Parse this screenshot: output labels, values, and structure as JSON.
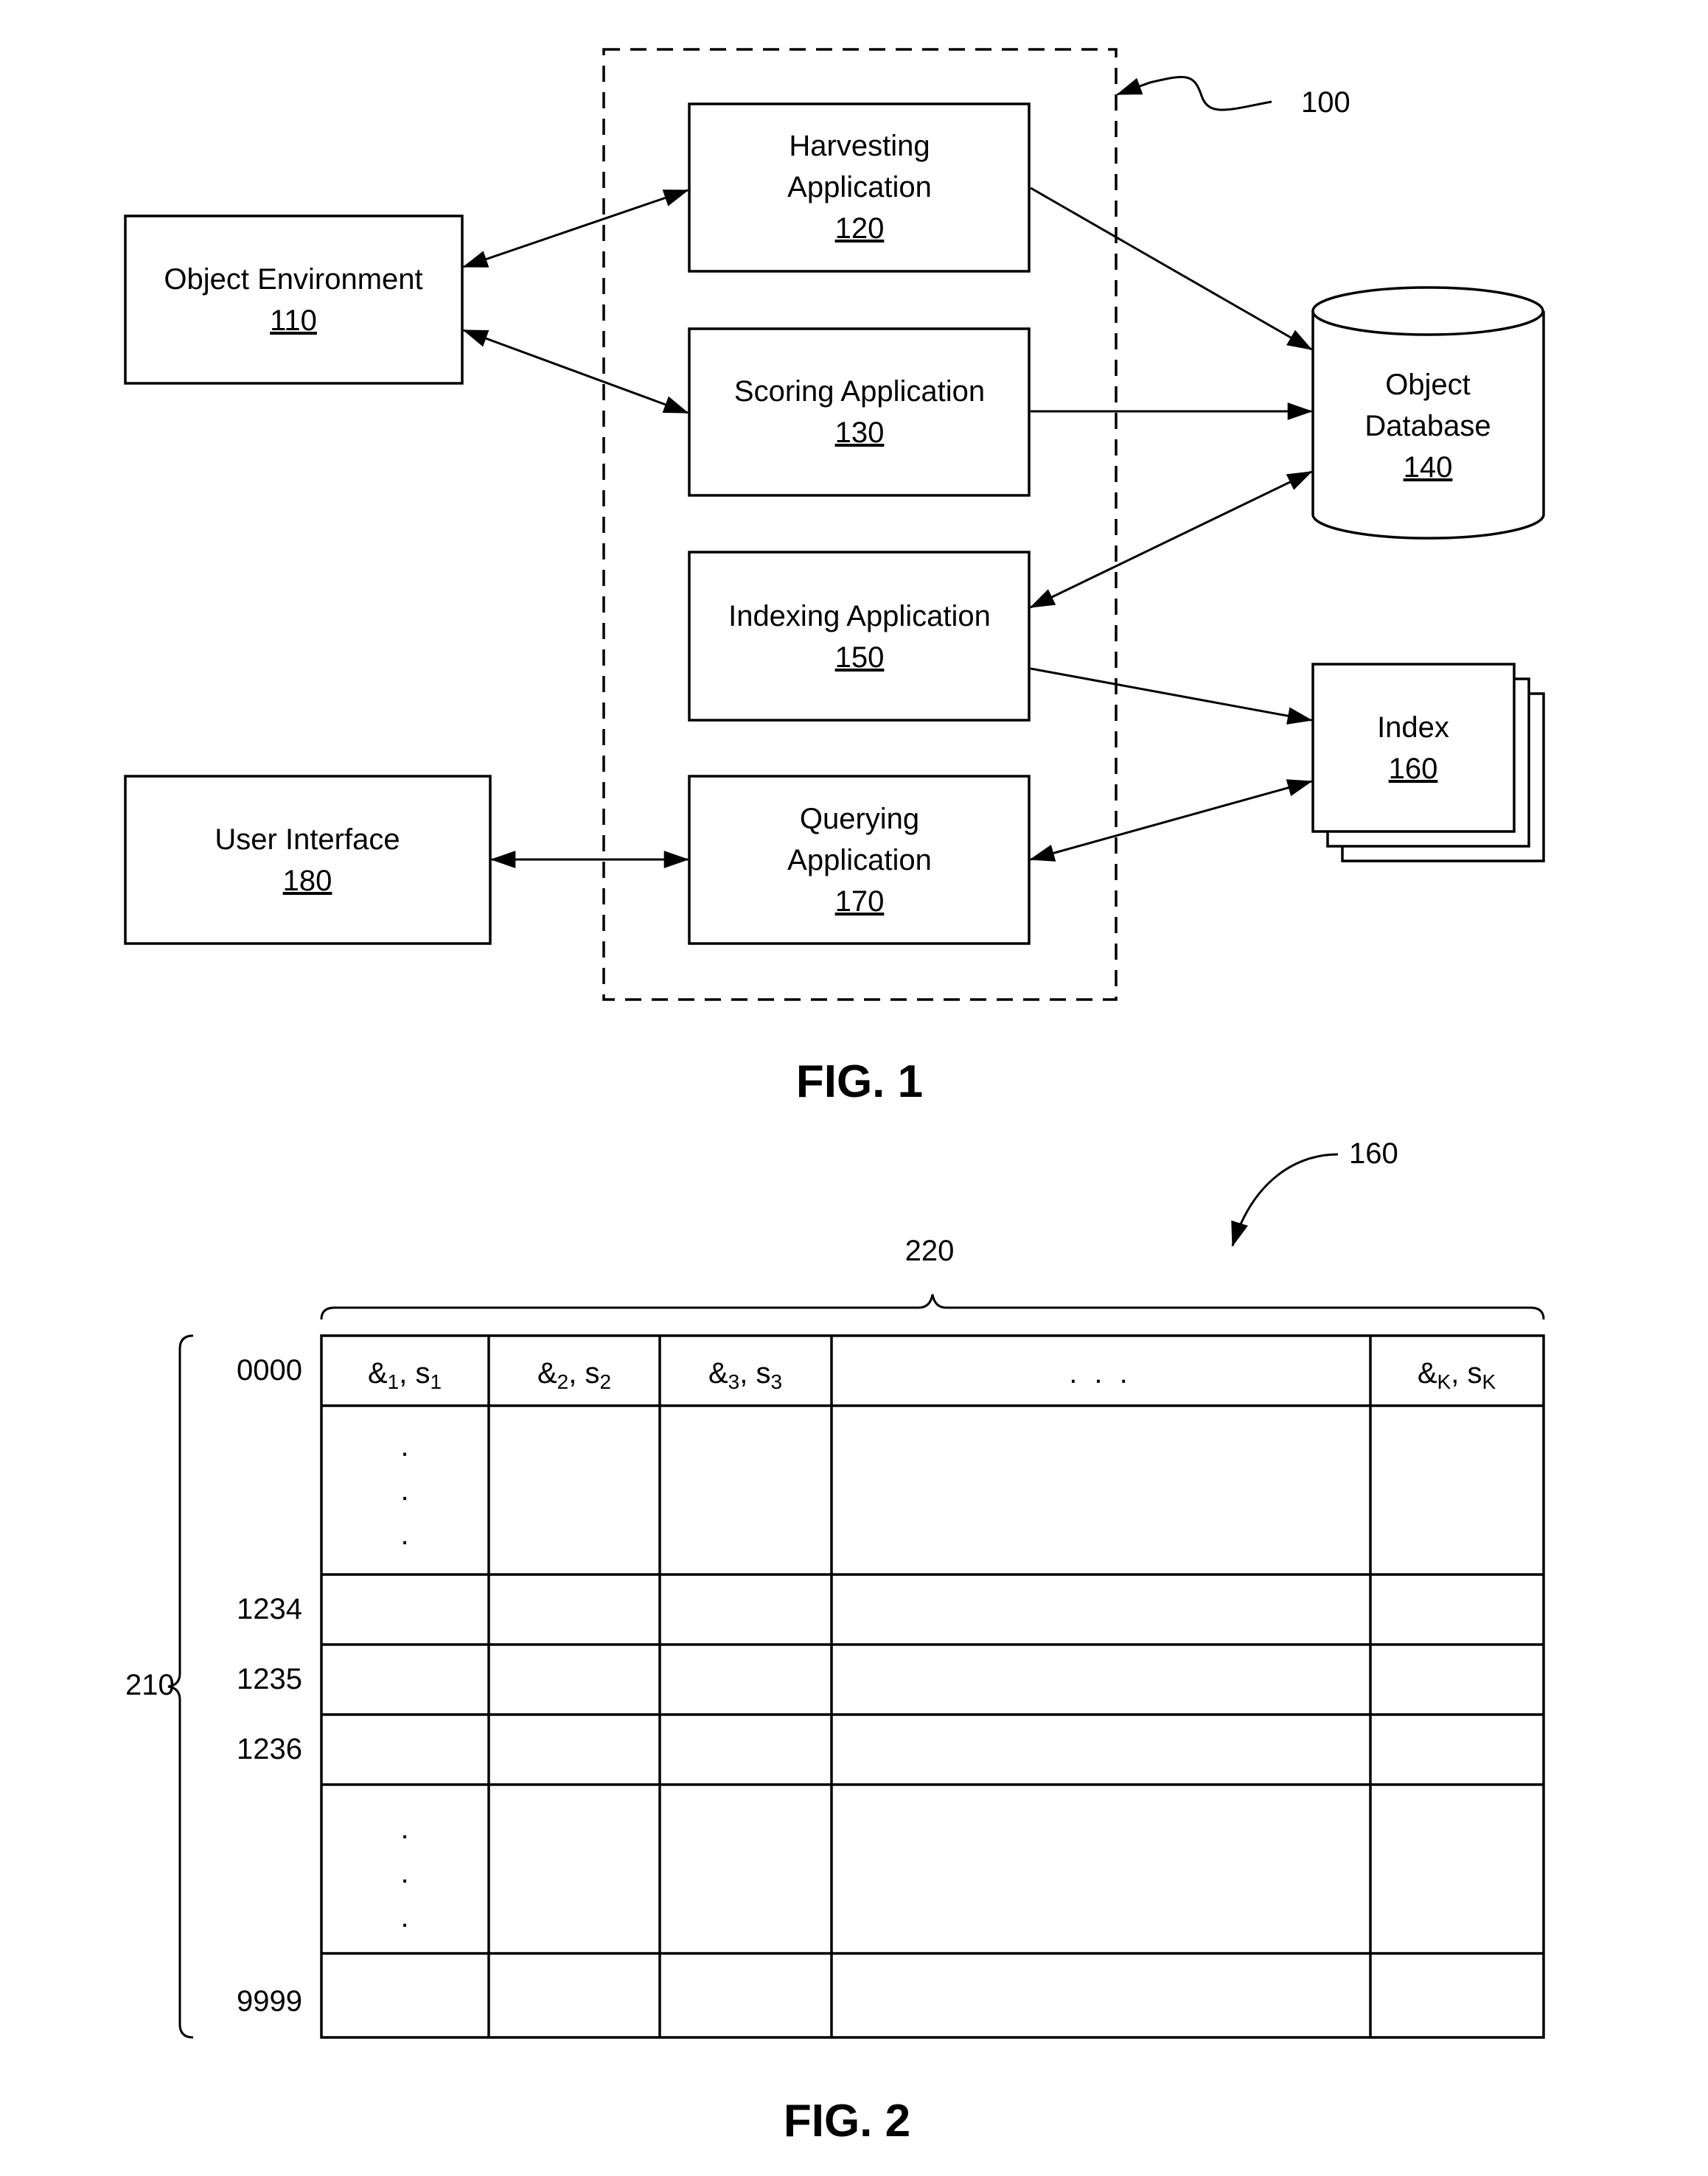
{
  "fig1": {
    "caption": "FIG. 1",
    "system_ref": "100",
    "nodes": {
      "object_environment": {
        "lines": [
          "Object Environment"
        ],
        "ref": "110"
      },
      "harvesting": {
        "lines": [
          "Harvesting",
          "Application"
        ],
        "ref": "120"
      },
      "scoring": {
        "lines": [
          "Scoring Application"
        ],
        "ref": "130"
      },
      "object_database": {
        "lines": [
          "Object",
          "Database"
        ],
        "ref": "140"
      },
      "indexing": {
        "lines": [
          "Indexing Application"
        ],
        "ref": "150"
      },
      "index": {
        "lines": [
          "Index"
        ],
        "ref": "160"
      },
      "querying": {
        "lines": [
          "Querying",
          "Application"
        ],
        "ref": "170"
      },
      "user_interface": {
        "lines": [
          "User Interface"
        ],
        "ref": "180"
      }
    },
    "edges": [
      {
        "from": "object_environment",
        "to": "harvesting",
        "direction": "both"
      },
      {
        "from": "object_environment",
        "to": "scoring",
        "direction": "both"
      },
      {
        "from": "harvesting",
        "to": "object_database",
        "direction": "forward"
      },
      {
        "from": "scoring",
        "to": "object_database",
        "direction": "forward"
      },
      {
        "from": "object_database",
        "to": "indexing",
        "direction": "both"
      },
      {
        "from": "indexing",
        "to": "index",
        "direction": "forward"
      },
      {
        "from": "index",
        "to": "querying",
        "direction": "both"
      },
      {
        "from": "user_interface",
        "to": "querying",
        "direction": "both"
      }
    ]
  },
  "fig2": {
    "caption": "FIG. 2",
    "table_ref": "160",
    "columns_ref": "220",
    "rows_ref": "210",
    "header": [
      {
        "main": "&",
        "sub1": "1",
        "sep": ", s",
        "sub2": "1"
      },
      {
        "main": "&",
        "sub1": "2",
        "sep": ", s",
        "sub2": "2"
      },
      {
        "main": "&",
        "sub1": "3",
        "sep": ", s",
        "sub2": "3"
      },
      {
        "ellipsis": ". . ."
      },
      {
        "main": "&",
        "sub1": "K",
        "sep": ", s",
        "sub2": "K"
      }
    ],
    "row_labels": [
      "0000",
      "",
      "1234",
      "1235",
      "1236",
      "",
      "9999"
    ],
    "vertical_ellipsis": "."
  }
}
